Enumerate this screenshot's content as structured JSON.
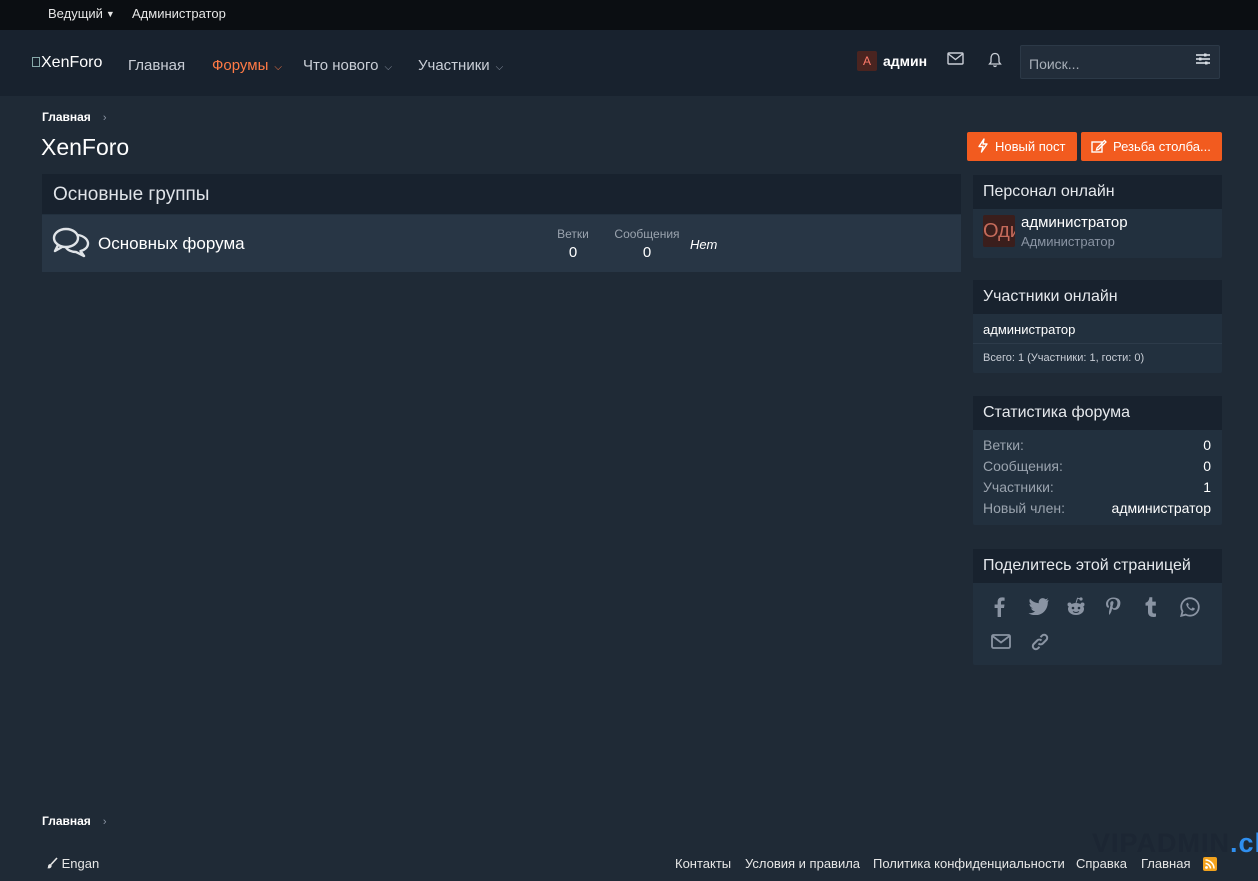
{
  "staffbar": {
    "leader_label": "Ведущий",
    "admin_label": "Администратор"
  },
  "header": {
    "logo_text": "XenForo",
    "nav": [
      {
        "label": "Главная"
      },
      {
        "label": "Форумы"
      },
      {
        "label": "Что нового"
      },
      {
        "label": "Участники"
      }
    ],
    "user_initial": "А",
    "user_name": "админ",
    "search_placeholder": "Поиск..."
  },
  "breadcrumb": {
    "home": "Главная"
  },
  "page": {
    "title": "XenForo"
  },
  "buttons": {
    "new_post": "Новый пост",
    "new_thread": "Резьба столба..."
  },
  "forum": {
    "category_title": "Основные группы",
    "node_title": "Основных форума",
    "threads_label": "Ветки",
    "threads_value": "0",
    "messages_label": "Сообщения",
    "messages_value": "0",
    "last_post": "Нет"
  },
  "staff_online": {
    "title": "Персонал онлайн",
    "avatar_text": "Один",
    "name": "администратор",
    "role": "Администратор"
  },
  "members_online": {
    "title": "Участники онлайн",
    "member": "администратор",
    "total": "Всего: 1 (Участники: 1, гости: 0)"
  },
  "forum_stats": {
    "title": "Статистика форума",
    "rows": [
      {
        "label": "Ветки:",
        "value": "0"
      },
      {
        "label": "Сообщения:",
        "value": "0"
      },
      {
        "label": "Участники:",
        "value": "1"
      },
      {
        "label": "Новый член:",
        "value": "администратор"
      }
    ]
  },
  "share": {
    "title": "Поделитесь этой страницей"
  },
  "footer": {
    "breadcrumb_home": "Главная",
    "style_label": "Engan",
    "links": [
      "Контакты",
      "Условия и правила",
      "Политика конфиденциальности",
      "Справка",
      "Главная"
    ]
  },
  "watermark": {
    "main": "VIPADMIN",
    "tld": ".club"
  },
  "colors": {
    "accent": "#f25b1f",
    "active_nav": "#ff7a45",
    "rss": "#f2a21d"
  }
}
